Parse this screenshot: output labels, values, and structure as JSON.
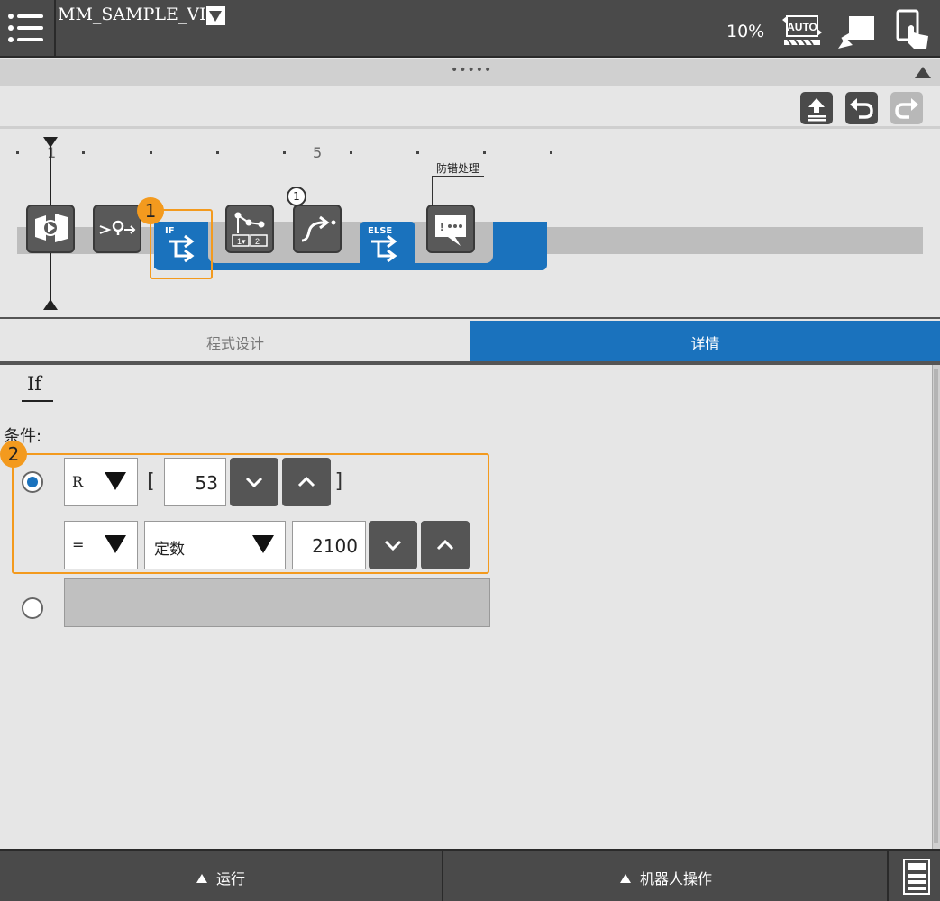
{
  "header": {
    "program_name": "MM_SAMPLE_VIZ",
    "speed": "10%",
    "mode_icon": "auto-mode-icon",
    "teach_icon": "teach-pendant-icon",
    "touch_icon": "touch-icon",
    "menu_icon": "hamburger-menu-icon"
  },
  "collapse": {
    "dots": "•••••"
  },
  "toolbar": {
    "upload_icon": "upload-icon",
    "undo_icon": "undo-icon",
    "redo_icon": "redo-icon"
  },
  "timeline": {
    "tick_1": "1",
    "tick_5": "5",
    "nodes": [
      {
        "name": "vision-program-node",
        "icon": "vision-icon"
      },
      {
        "name": "move-to-node",
        "icon": "waypoint-icon"
      },
      {
        "name": "if-node",
        "tag": "IF",
        "icon": "branch-icon"
      },
      {
        "name": "multi-route-node",
        "icon": "path-select-icon",
        "tag_a": "1",
        "tag_b": "2"
      },
      {
        "name": "jump-node",
        "icon": "jump-icon",
        "badge": "1"
      },
      {
        "name": "else-node",
        "tag": "ELSE",
        "icon": "branch-icon"
      },
      {
        "name": "message-node",
        "icon": "message-icon",
        "callout": "防错处理"
      }
    ],
    "highlight_badge": "1"
  },
  "tabs": {
    "program": "程式设计",
    "detail": "详情"
  },
  "detail": {
    "title": "If",
    "condition_label": "条件:",
    "highlight_badge": "2",
    "condition": {
      "register_type": "R",
      "bracket_open": "[",
      "bracket_close": "]",
      "register_index": "53",
      "operator": "=",
      "value_type": "定数",
      "value": "2100"
    }
  },
  "bottom": {
    "run": "运行",
    "robot_ops": "机器人操作",
    "controller_icon": "controller-icon"
  },
  "colors": {
    "accent_blue": "#1a72bd",
    "highlight_orange": "#f39a1e",
    "bar_dark": "#4a4a4a"
  }
}
